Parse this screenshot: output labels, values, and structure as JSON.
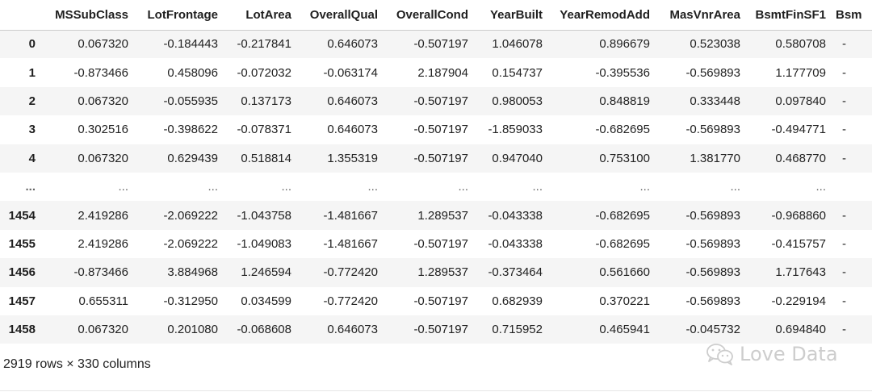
{
  "dataframe": {
    "columns": [
      "MSSubClass",
      "LotFrontage",
      "LotArea",
      "OverallQual",
      "OverallCond",
      "YearBuilt",
      "YearRemodAdd",
      "MasVnrArea",
      "BsmtFinSF1",
      "Bsm"
    ],
    "rows": [
      {
        "index": "0",
        "values": [
          "0.067320",
          "-0.184443",
          "-0.217841",
          "0.646073",
          "-0.507197",
          "1.046078",
          "0.896679",
          "0.523038",
          "0.580708",
          "-"
        ]
      },
      {
        "index": "1",
        "values": [
          "-0.873466",
          "0.458096",
          "-0.072032",
          "-0.063174",
          "2.187904",
          "0.154737",
          "-0.395536",
          "-0.569893",
          "1.177709",
          "-"
        ]
      },
      {
        "index": "2",
        "values": [
          "0.067320",
          "-0.055935",
          "0.137173",
          "0.646073",
          "-0.507197",
          "0.980053",
          "0.848819",
          "0.333448",
          "0.097840",
          "-"
        ]
      },
      {
        "index": "3",
        "values": [
          "0.302516",
          "-0.398622",
          "-0.078371",
          "0.646073",
          "-0.507197",
          "-1.859033",
          "-0.682695",
          "-0.569893",
          "-0.494771",
          "-"
        ]
      },
      {
        "index": "4",
        "values": [
          "0.067320",
          "0.629439",
          "0.518814",
          "1.355319",
          "-0.507197",
          "0.947040",
          "0.753100",
          "1.381770",
          "0.468770",
          "-"
        ]
      },
      {
        "index": "...",
        "values": [
          "...",
          "...",
          "...",
          "...",
          "...",
          "...",
          "...",
          "...",
          "...",
          ""
        ]
      },
      {
        "index": "1454",
        "values": [
          "2.419286",
          "-2.069222",
          "-1.043758",
          "-1.481667",
          "1.289537",
          "-0.043338",
          "-0.682695",
          "-0.569893",
          "-0.968860",
          "-"
        ]
      },
      {
        "index": "1455",
        "values": [
          "2.419286",
          "-2.069222",
          "-1.049083",
          "-1.481667",
          "-0.507197",
          "-0.043338",
          "-0.682695",
          "-0.569893",
          "-0.415757",
          "-"
        ]
      },
      {
        "index": "1456",
        "values": [
          "-0.873466",
          "3.884968",
          "1.246594",
          "-0.772420",
          "1.289537",
          "-0.373464",
          "0.561660",
          "-0.569893",
          "1.717643",
          "-"
        ]
      },
      {
        "index": "1457",
        "values": [
          "0.655311",
          "-0.312950",
          "0.034599",
          "-0.772420",
          "-0.507197",
          "0.682939",
          "0.370221",
          "-0.569893",
          "-0.229194",
          "-"
        ]
      },
      {
        "index": "1458",
        "values": [
          "0.067320",
          "0.201080",
          "-0.068608",
          "0.646073",
          "-0.507197",
          "0.715952",
          "0.465941",
          "-0.045732",
          "0.694840",
          "-"
        ]
      }
    ]
  },
  "footer": {
    "shape_text": "2919 rows × 330 columns"
  },
  "watermark": {
    "text": "Love Data",
    "icon": "wechat-icon"
  },
  "colors": {
    "stripe": "#f5f5f5",
    "header_border": "#cccccc",
    "watermark": "#c8c8c8"
  }
}
